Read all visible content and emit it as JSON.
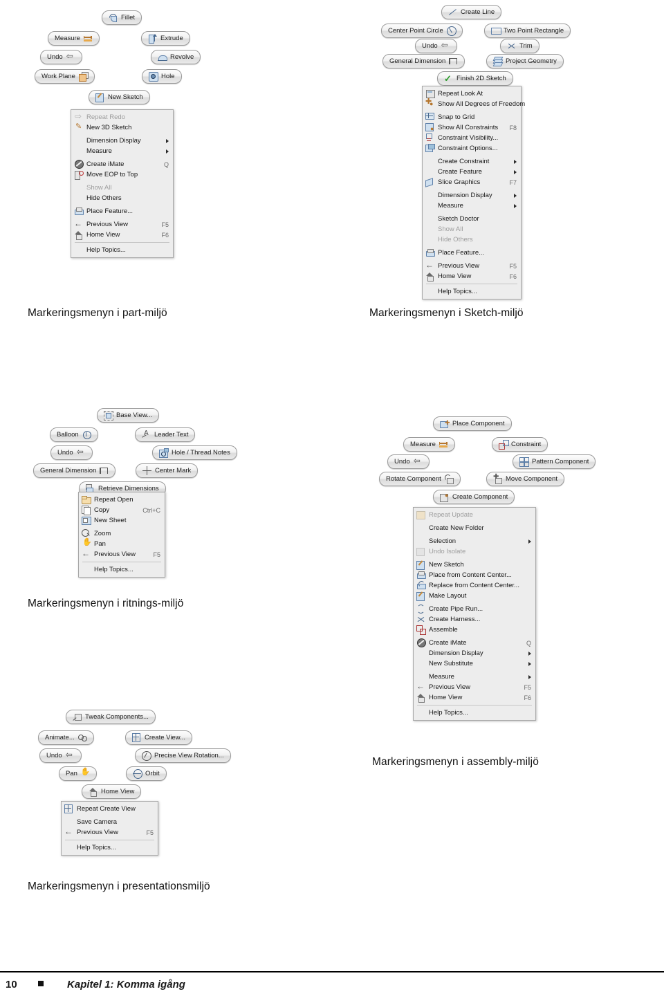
{
  "page": {
    "number": "10",
    "chapter": "Kapitel 1: Komma igång"
  },
  "captions": {
    "part": "Markeringsmenyn i part-miljö",
    "sketch": "Markeringsmenyn i Sketch-miljö",
    "drawing": "Markeringsmenyn i ritnings-miljö",
    "assembly": "Markeringsmenyn i assembly-miljö",
    "presentation": "Markeringsmenyn i presentationsmiljö"
  },
  "part_menu": {
    "pills": [
      {
        "label": "Fillet",
        "icon": "fillet-icon"
      },
      {
        "label": "Measure",
        "icon": "measure-icon"
      },
      {
        "label": "Extrude",
        "icon": "extrude-icon"
      },
      {
        "label": "Undo",
        "icon": "undo-icon"
      },
      {
        "label": "Revolve",
        "icon": "revolve-icon"
      },
      {
        "label": "Work Plane",
        "icon": "work-plane-icon"
      },
      {
        "label": "Hole",
        "icon": "hole-icon"
      },
      {
        "label": "New Sketch",
        "icon": "new-sketch-icon"
      }
    ],
    "items": [
      {
        "label": "Repeat Redo",
        "accel": "",
        "icon": "redo-icon",
        "disabled": true,
        "arrow": false
      },
      {
        "label": "New 3D Sketch",
        "accel": "",
        "icon": "new-3d-sketch-icon",
        "disabled": false,
        "arrow": false
      },
      {
        "label": "Dimension Display",
        "accel": "",
        "icon": "",
        "disabled": false,
        "arrow": true
      },
      {
        "label": "Measure",
        "accel": "",
        "icon": "",
        "disabled": false,
        "arrow": true
      },
      {
        "label": "Create iMate",
        "accel": "Q",
        "icon": "imate-icon",
        "disabled": false,
        "arrow": false
      },
      {
        "label": "Move EOP to Top",
        "accel": "",
        "icon": "move-eop-icon",
        "disabled": false,
        "arrow": false
      },
      {
        "label": "Show All",
        "accel": "",
        "icon": "",
        "disabled": true,
        "arrow": false
      },
      {
        "label": "Hide Others",
        "accel": "",
        "icon": "",
        "disabled": false,
        "arrow": false
      },
      {
        "label": "Place Feature...",
        "accel": "",
        "icon": "place-feature-icon",
        "disabled": false,
        "arrow": false
      },
      {
        "label": "Previous View",
        "accel": "F5",
        "icon": "previous-view-icon",
        "disabled": false,
        "arrow": false
      },
      {
        "label": "Home View",
        "accel": "F6",
        "icon": "home-view-icon",
        "disabled": false,
        "arrow": false
      },
      {
        "label": "Help Topics...",
        "accel": "",
        "icon": "",
        "disabled": false,
        "arrow": false
      }
    ]
  },
  "sketch_menu": {
    "pills": [
      {
        "label": "Create Line",
        "icon": "create-line-icon"
      },
      {
        "label": "Center Point Circle",
        "icon": "center-point-circle-icon"
      },
      {
        "label": "Two Point Rectangle",
        "icon": "two-point-rectangle-icon"
      },
      {
        "label": "Undo",
        "icon": "undo-icon"
      },
      {
        "label": "Trim",
        "icon": "trim-icon"
      },
      {
        "label": "General Dimension",
        "icon": "general-dimension-icon"
      },
      {
        "label": "Project Geometry",
        "icon": "project-geometry-icon"
      },
      {
        "label": "Finish 2D Sketch",
        "icon": "check-icon"
      }
    ],
    "items": [
      {
        "label": "Repeat Look At",
        "accel": "",
        "icon": "look-at-icon",
        "disabled": false,
        "arrow": false
      },
      {
        "label": "Show All Degrees of Freedom",
        "accel": "",
        "icon": "dof-icon",
        "disabled": false,
        "arrow": false
      },
      {
        "label": "Snap to Grid",
        "accel": "",
        "icon": "snap-grid-icon",
        "disabled": false,
        "arrow": false
      },
      {
        "label": "Show All Constraints",
        "accel": "F8",
        "icon": "show-constraints-icon",
        "disabled": false,
        "arrow": false
      },
      {
        "label": "Constraint Visibility...",
        "accel": "",
        "icon": "constraint-vis-icon",
        "disabled": false,
        "arrow": false
      },
      {
        "label": "Constraint Options...",
        "accel": "",
        "icon": "constraint-opt-icon",
        "disabled": false,
        "arrow": false
      },
      {
        "label": "Create Constraint",
        "accel": "",
        "icon": "",
        "disabled": false,
        "arrow": true
      },
      {
        "label": "Create Feature",
        "accel": "",
        "icon": "",
        "disabled": false,
        "arrow": true
      },
      {
        "label": "Slice Graphics",
        "accel": "F7",
        "icon": "slice-graphics-icon",
        "disabled": false,
        "arrow": false
      },
      {
        "label": "Dimension Display",
        "accel": "",
        "icon": "",
        "disabled": false,
        "arrow": true
      },
      {
        "label": "Measure",
        "accel": "",
        "icon": "",
        "disabled": false,
        "arrow": true
      },
      {
        "label": "Sketch Doctor",
        "accel": "",
        "icon": "",
        "disabled": false,
        "arrow": false
      },
      {
        "label": "Show All",
        "accel": "",
        "icon": "",
        "disabled": true,
        "arrow": false
      },
      {
        "label": "Hide Others",
        "accel": "",
        "icon": "",
        "disabled": true,
        "arrow": false
      },
      {
        "label": "Place Feature...",
        "accel": "",
        "icon": "place-feature-icon",
        "disabled": false,
        "arrow": false
      },
      {
        "label": "Previous View",
        "accel": "F5",
        "icon": "previous-view-icon",
        "disabled": false,
        "arrow": false
      },
      {
        "label": "Home View",
        "accel": "F6",
        "icon": "home-view-icon",
        "disabled": false,
        "arrow": false
      },
      {
        "label": "Help Topics...",
        "accel": "",
        "icon": "",
        "disabled": false,
        "arrow": false
      }
    ]
  },
  "drawing_menu": {
    "pills": [
      {
        "label": "Base View...",
        "icon": "base-view-icon"
      },
      {
        "label": "Balloon",
        "icon": "balloon-icon"
      },
      {
        "label": "Leader Text",
        "icon": "leader-text-icon"
      },
      {
        "label": "Undo",
        "icon": "undo-icon"
      },
      {
        "label": "Hole / Thread Notes",
        "icon": "hole-thread-notes-icon"
      },
      {
        "label": "General Dimension",
        "icon": "general-dimension-icon"
      },
      {
        "label": "Center Mark",
        "icon": "center-mark-icon"
      },
      {
        "label": "Retrieve Dimensions",
        "icon": "retrieve-dimensions-icon"
      }
    ],
    "items": [
      {
        "label": "Repeat Open",
        "accel": "",
        "icon": "open-icon",
        "disabled": false,
        "arrow": false
      },
      {
        "label": "Copy",
        "accel": "Ctrl+C",
        "icon": "copy-icon",
        "disabled": false,
        "arrow": false
      },
      {
        "label": "New Sheet",
        "accel": "",
        "icon": "new-sheet-icon",
        "disabled": false,
        "arrow": false
      },
      {
        "label": "Zoom",
        "accel": "",
        "icon": "zoom-icon",
        "disabled": false,
        "arrow": false
      },
      {
        "label": "Pan",
        "accel": "",
        "icon": "pan-icon",
        "disabled": false,
        "arrow": false
      },
      {
        "label": "Previous View",
        "accel": "F5",
        "icon": "previous-view-icon",
        "disabled": false,
        "arrow": false
      },
      {
        "label": "Help Topics...",
        "accel": "",
        "icon": "",
        "disabled": false,
        "arrow": false
      }
    ]
  },
  "assembly_menu": {
    "pills": [
      {
        "label": "Place Component",
        "icon": "place-component-icon"
      },
      {
        "label": "Measure",
        "icon": "measure-icon"
      },
      {
        "label": "Constraint",
        "icon": "constraint-icon"
      },
      {
        "label": "Undo",
        "icon": "undo-icon"
      },
      {
        "label": "Pattern Component",
        "icon": "pattern-component-icon"
      },
      {
        "label": "Rotate Component",
        "icon": "rotate-component-icon"
      },
      {
        "label": "Move Component",
        "icon": "move-component-icon"
      },
      {
        "label": "Create Component",
        "icon": "create-component-icon"
      }
    ],
    "items": [
      {
        "label": "Repeat Update",
        "accel": "",
        "icon": "update-icon",
        "disabled": true,
        "arrow": false
      },
      {
        "label": "Create New Folder",
        "accel": "",
        "icon": "",
        "disabled": false,
        "arrow": false
      },
      {
        "label": "Selection",
        "accel": "",
        "icon": "",
        "disabled": false,
        "arrow": true
      },
      {
        "label": "Undo Isolate",
        "accel": "",
        "icon": "undo-isolate-icon",
        "disabled": true,
        "arrow": false
      },
      {
        "label": "New Sketch",
        "accel": "",
        "icon": "new-sketch-icon",
        "disabled": false,
        "arrow": false
      },
      {
        "label": "Place from Content Center...",
        "accel": "",
        "icon": "place-content-icon",
        "disabled": false,
        "arrow": false
      },
      {
        "label": "Replace from Content Center...",
        "accel": "",
        "icon": "replace-content-icon",
        "disabled": false,
        "arrow": false
      },
      {
        "label": "Make Layout",
        "accel": "",
        "icon": "make-layout-icon",
        "disabled": false,
        "arrow": false
      },
      {
        "label": "Create Pipe Run...",
        "accel": "",
        "icon": "pipe-run-icon",
        "disabled": false,
        "arrow": false
      },
      {
        "label": "Create Harness...",
        "accel": "",
        "icon": "harness-icon",
        "disabled": false,
        "arrow": false
      },
      {
        "label": "Assemble",
        "accel": "",
        "icon": "assemble-icon",
        "disabled": false,
        "arrow": false
      },
      {
        "label": "Create iMate",
        "accel": "Q",
        "icon": "imate-icon",
        "disabled": false,
        "arrow": false
      },
      {
        "label": "Dimension Display",
        "accel": "",
        "icon": "",
        "disabled": false,
        "arrow": true
      },
      {
        "label": "New Substitute",
        "accel": "",
        "icon": "",
        "disabled": false,
        "arrow": true
      },
      {
        "label": "Measure",
        "accel": "",
        "icon": "",
        "disabled": false,
        "arrow": true
      },
      {
        "label": "Previous View",
        "accel": "F5",
        "icon": "previous-view-icon",
        "disabled": false,
        "arrow": false
      },
      {
        "label": "Home View",
        "accel": "F6",
        "icon": "home-view-icon",
        "disabled": false,
        "arrow": false
      },
      {
        "label": "Help Topics...",
        "accel": "",
        "icon": "",
        "disabled": false,
        "arrow": false
      }
    ]
  },
  "presentation_menu": {
    "pills": [
      {
        "label": "Tweak Components...",
        "icon": "tweak-components-icon"
      },
      {
        "label": "Animate...",
        "icon": "animate-icon"
      },
      {
        "label": "Create View...",
        "icon": "create-view-icon"
      },
      {
        "label": "Undo",
        "icon": "undo-icon"
      },
      {
        "label": "Precise View Rotation...",
        "icon": "precise-rotation-icon"
      },
      {
        "label": "Pan",
        "icon": "pan-icon"
      },
      {
        "label": "Orbit",
        "icon": "orbit-icon"
      },
      {
        "label": "Home View",
        "icon": "home-view-icon"
      }
    ],
    "items": [
      {
        "label": "Repeat Create View",
        "accel": "",
        "icon": "create-view-icon",
        "disabled": false,
        "arrow": false
      },
      {
        "label": "Save Camera",
        "accel": "",
        "icon": "",
        "disabled": false,
        "arrow": false
      },
      {
        "label": "Previous View",
        "accel": "F5",
        "icon": "previous-view-icon",
        "disabled": false,
        "arrow": false
      },
      {
        "label": "Help Topics...",
        "accel": "",
        "icon": "",
        "disabled": false,
        "arrow": false
      }
    ]
  }
}
